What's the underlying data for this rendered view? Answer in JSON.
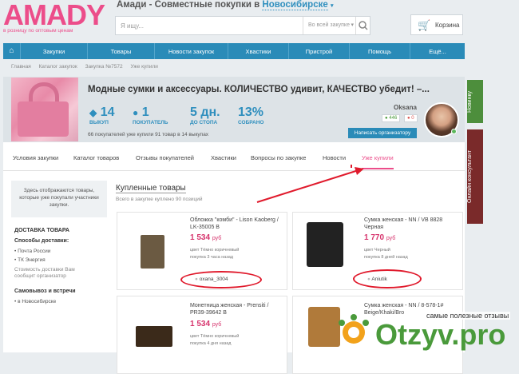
{
  "logo": {
    "main": "AMADY",
    "tagline": "в розницу по оптовым ценам"
  },
  "site_title": {
    "text": "Амади - Совместные покупки в",
    "city": "Новосибирске"
  },
  "search": {
    "placeholder": "Я ищу...",
    "scope": "Во всей закупке"
  },
  "cart": {
    "label": "Корзина"
  },
  "nav": [
    "Закупки",
    "Товары",
    "Новости закупок",
    "Хвастики",
    "Пристрой",
    "Помощь",
    "Ещё..."
  ],
  "breadcrumb": [
    "Главная",
    "Каталог закупок",
    "Закупка №7572",
    "Уже купили"
  ],
  "purchase": {
    "title": "Модные сумки и аксессуары. КОЛИЧЕСТВО удивит, КАЧЕСТВО убедит! –...",
    "stats": [
      {
        "value": "14",
        "label": "ВЫКУП"
      },
      {
        "value": "1",
        "label": "ПОКУПАТЕЛЬ"
      },
      {
        "value": "5 дн.",
        "label": "ДО СТОПА"
      },
      {
        "value": "13%",
        "label": "СОБРАНО"
      }
    ],
    "note": "66 покупателей уже купили 91 товар в 14 выкупах"
  },
  "organizer": {
    "name": "Oksana",
    "positive": "446",
    "negative": "0",
    "write_label": "Написать организатору"
  },
  "tabs": [
    "Условия закупки",
    "Каталог товаров",
    "Отзывы покупателей",
    "Хвастики",
    "Вопросы по закупке",
    "Новости",
    "Уже купили"
  ],
  "sidebar": {
    "note": "Здесь отображаются товары, которые уже покупали участники закупки.",
    "delivery_title": "ДОСТАВКА ТОВАРА",
    "methods_title": "Способы доставки:",
    "methods": [
      "Почта России",
      "ТК Энергия"
    ],
    "methods_note": "Стоимость доставки Вам сообщит организатор",
    "pickup_title": "Самовывоз и встречи",
    "pickup": [
      "в Новосибирске"
    ]
  },
  "section": {
    "title": "Купленные товары",
    "subtitle": "Всего в закупке куплено 90 позиций"
  },
  "items": [
    {
      "title": "Обложка \"комби\" - Lison Kaoberg / LK-35005 В",
      "price": "1 534",
      "currency": "руб",
      "color": "цвет Тёмно коричневый",
      "bought": "покупка 3 часа назад",
      "buyer": "oxana_3004"
    },
    {
      "title": "Сумка женская - NN / VB 8828 Черная",
      "price": "1 770",
      "currency": "руб",
      "color": "цвет Черный",
      "bought": "покупка 8 дней назад",
      "buyer": "Aniutik"
    },
    {
      "title": "Монетница женская - Prensiti / PR39-39642 В",
      "price": "1 534",
      "currency": "руб",
      "color": "цвет Тёмно коричневый",
      "bought": "покупка 4 дня назад",
      "buyer": ""
    },
    {
      "title": "Сумка женская - NN / 8-578-1# Beige/Khaki/Bro",
      "price": "",
      "currency": "",
      "color": "",
      "bought": "",
      "buyer": ""
    }
  ],
  "right_tabs": [
    "Новинку",
    "Онлайн консультант"
  ],
  "watermark": {
    "top": "самые полезные отзывы",
    "brand": "Otzyv.pro"
  }
}
